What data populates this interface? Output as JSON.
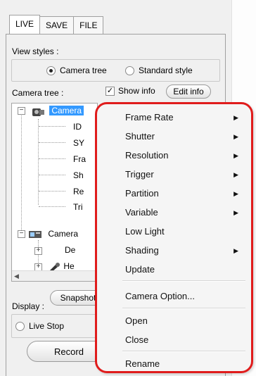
{
  "tabs": [
    {
      "label": "LIVE"
    },
    {
      "label": "SAVE"
    },
    {
      "label": "FILE"
    }
  ],
  "view_styles": {
    "label": "View styles :",
    "camera_tree_option": "Camera tree",
    "standard_style_option": "Standard style",
    "selected": "Camera tree"
  },
  "camera_tree": {
    "label": "Camera tree :",
    "show_info_label": "Show info",
    "show_info_checked": true,
    "edit_info_button": "Edit info",
    "nodes": {
      "camera1": "Camera",
      "id": "ID",
      "sy": "SY",
      "fra": "Fra",
      "sh": "Sh",
      "re": "Re",
      "tri": "Tri",
      "camera2": "Camera",
      "de": "De",
      "he": "He"
    }
  },
  "snapshot_button": "Snapshot",
  "display": {
    "label": "Display :",
    "live_stop_option": "Live Stop"
  },
  "record_button": "Record",
  "context_menu": {
    "items": [
      {
        "label": "Frame Rate",
        "submenu": true
      },
      {
        "label": "Shutter",
        "submenu": true
      },
      {
        "label": "Resolution",
        "submenu": true
      },
      {
        "label": "Trigger",
        "submenu": true
      },
      {
        "label": "Partition",
        "submenu": true
      },
      {
        "label": "Variable",
        "submenu": true
      },
      {
        "label": "Low Light",
        "submenu": false
      },
      {
        "label": "Shading",
        "submenu": true
      },
      {
        "label": "Update",
        "submenu": false
      },
      {
        "label": "Camera Option...",
        "submenu": false
      },
      {
        "label": "Open",
        "submenu": false
      },
      {
        "label": "Close",
        "submenu": false
      },
      {
        "label": "Rename",
        "submenu": false
      }
    ]
  },
  "colors": {
    "highlight": "#e01c1c",
    "selection": "#3399ff"
  }
}
